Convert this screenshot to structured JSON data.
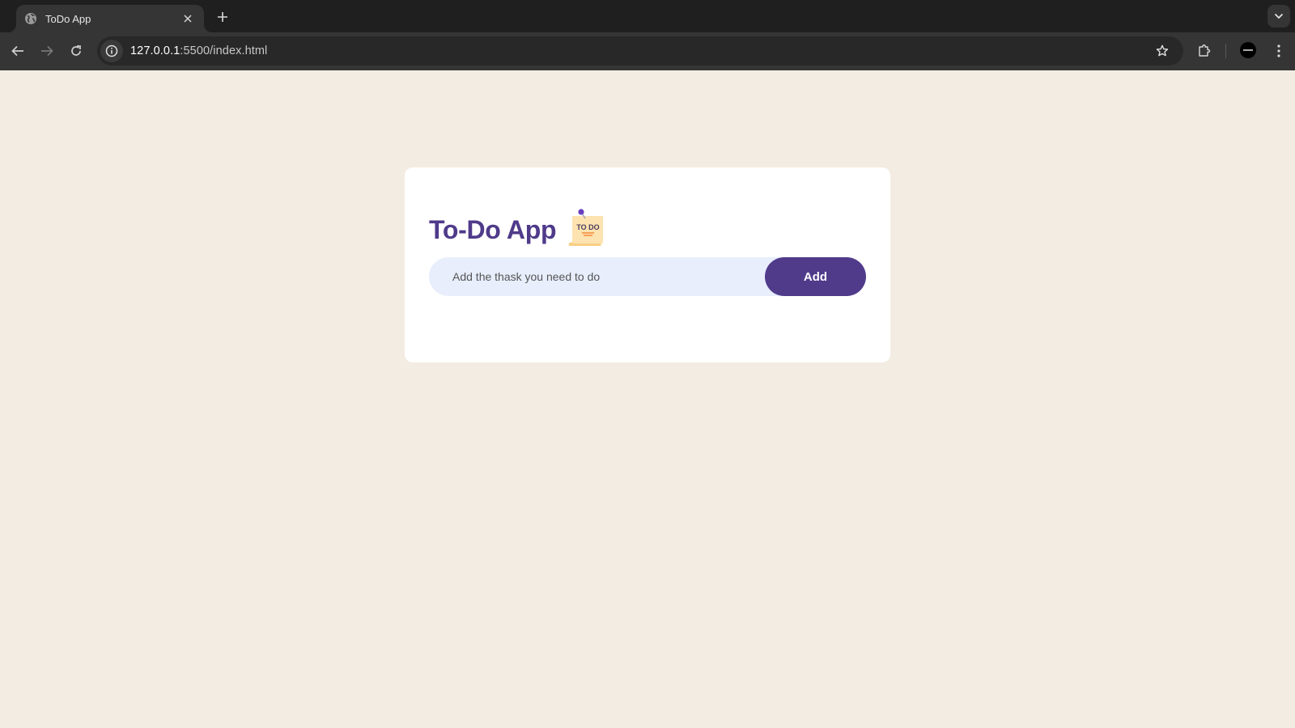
{
  "browser": {
    "tab": {
      "title": "ToDo App",
      "favicon": "globe-icon",
      "close_icon": "close-icon"
    },
    "new_tab_icon": "plus-icon",
    "tab_search_icon": "chevron-down-icon",
    "nav": {
      "back_icon": "arrow-left-icon",
      "forward_icon": "arrow-right-icon",
      "reload_icon": "reload-icon"
    },
    "address_bar": {
      "site_info_icon": "info-icon",
      "host": "127.0.0.1",
      "path": ":5500/index.html",
      "bookmark_icon": "star-icon"
    },
    "extensions_icon": "puzzle-icon",
    "profile_icon": "avatar",
    "menu_icon": "kebab-menu-icon"
  },
  "app": {
    "title": "To-Do App",
    "title_icon": "todo-note-icon",
    "title_icon_text": "TO DO",
    "input": {
      "value": "",
      "placeholder": "Add the thask you need to do"
    },
    "add_button_label": "Add",
    "tasks": []
  },
  "colors": {
    "page_background": "#f3ece2",
    "card_background": "#ffffff",
    "accent": "#503b8b",
    "input_background": "#e8eefc"
  }
}
